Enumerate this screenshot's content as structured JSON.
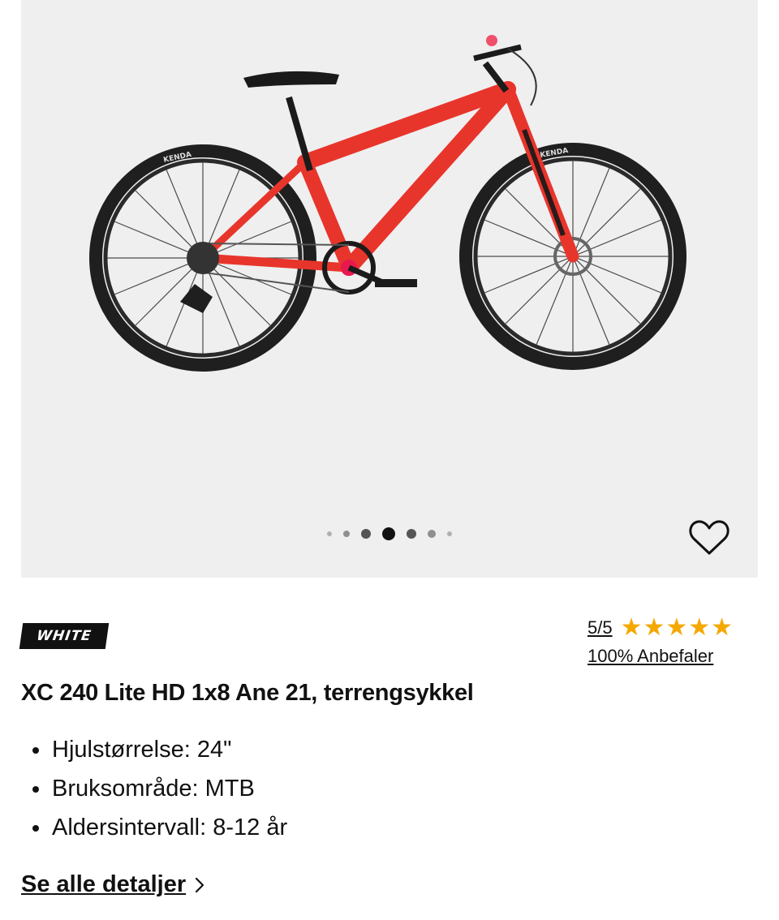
{
  "gallery": {
    "image_alt": "XC 240 Lite HD 1x8 Ane 21, terrengsykkel",
    "tire_brand": "KENDA",
    "frame_color": "#e8352b",
    "dots_count": 7,
    "active_dot": 3
  },
  "brand": {
    "logo_text": "WHITE"
  },
  "rating": {
    "score": "5/5",
    "stars": "★★★★★",
    "recommend": "100% Anbefaler",
    "star_color": "#f5a800"
  },
  "product": {
    "title": "XC 240 Lite HD 1x8 Ane 21, terrengsykkel",
    "specs": [
      "Hjulstørrelse: 24\"",
      "Bruksområde: MTB",
      "Aldersintervall: 8-12 år"
    ]
  },
  "details": {
    "label": "Se alle detaljer"
  }
}
